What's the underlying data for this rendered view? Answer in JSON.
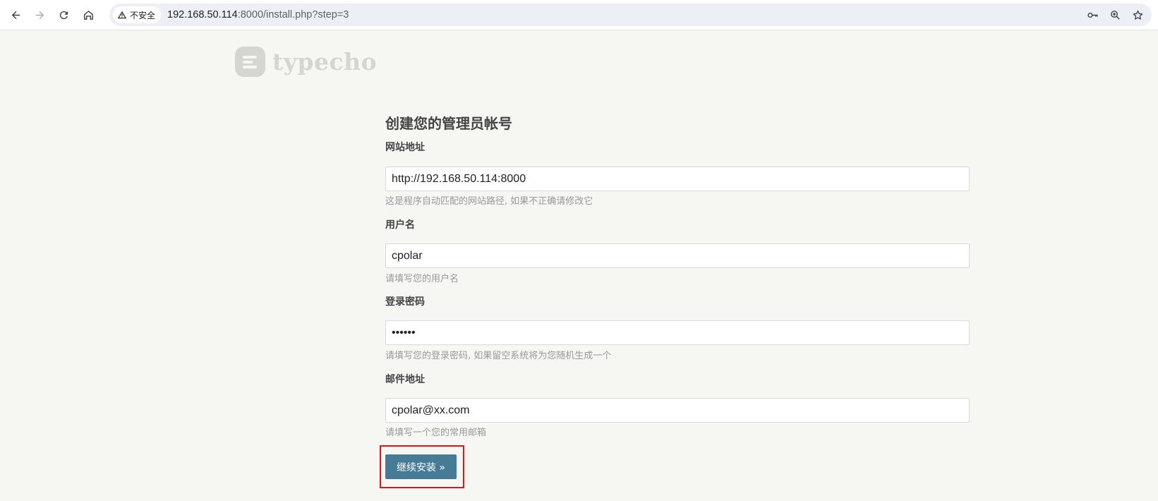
{
  "browser": {
    "security_label": "不安全",
    "url_host": "192.168.50.114",
    "url_rest": ":8000/install.php?step=3",
    "icons": [
      "back-icon",
      "forward-icon",
      "reload-icon",
      "home-icon",
      "warning-icon",
      "key-icon",
      "zoom-icon",
      "star-icon"
    ]
  },
  "logo": {
    "text": "typecho"
  },
  "form": {
    "title": "创建您的管理员帐号",
    "fields": [
      {
        "label": "网站地址",
        "value": "http://192.168.50.114:8000",
        "description": "这是程序自动匹配的网站路径, 如果不正确请修改它"
      },
      {
        "label": "用户名",
        "value": "cpolar",
        "description": "请填写您的用户名"
      },
      {
        "label": "登录密码",
        "value": "••••••",
        "description": "请填写您的登录密码, 如果留空系统将为您随机生成一个"
      },
      {
        "label": "邮件地址",
        "value": "cpolar@xx.com",
        "description": "请填写一个您的常用邮箱"
      }
    ],
    "submit_label": "继续安装 »"
  },
  "colors": {
    "page_bg": "#f6f6f3",
    "button_bg": "#467b96",
    "highlight": "#e21515",
    "logo_gray": "#d5d5d2"
  }
}
